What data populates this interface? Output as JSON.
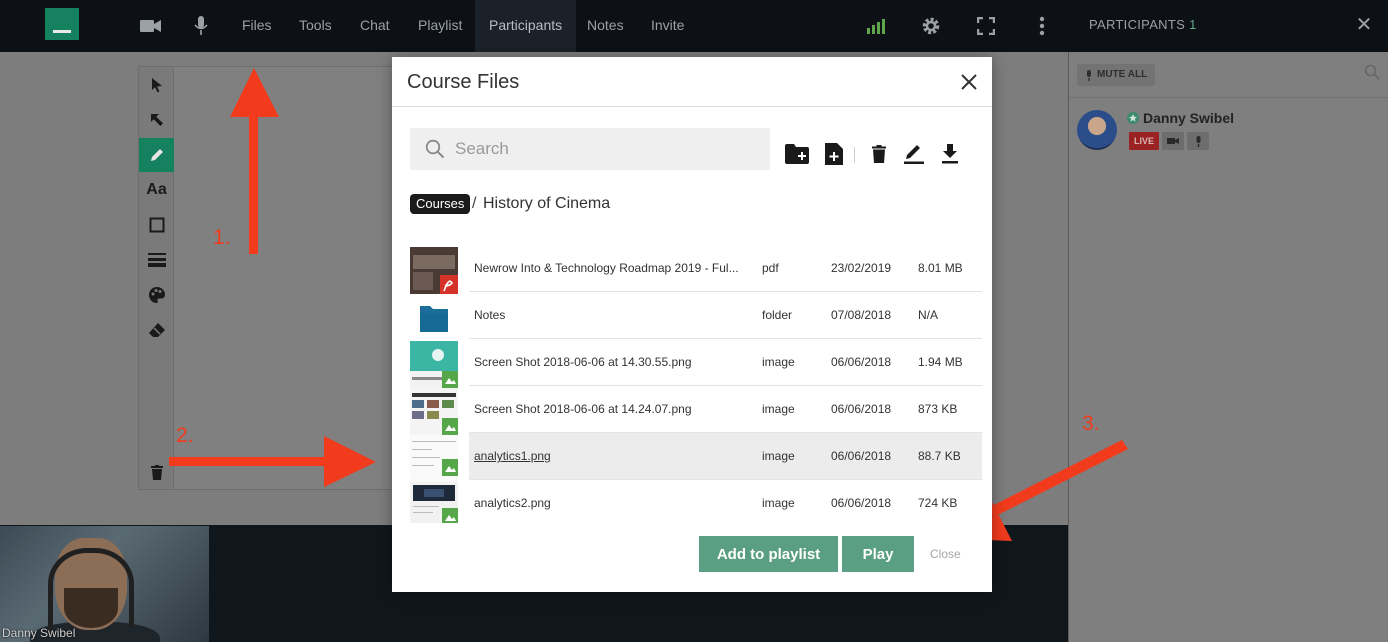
{
  "topbar": {
    "nav": [
      "Files",
      "Tools",
      "Chat",
      "Playlist",
      "Participants",
      "Notes",
      "Invite"
    ],
    "active_nav": "Participants",
    "participants_title": "PARTICIPANTS",
    "participants_count": "1"
  },
  "sidebar": {
    "mute_all_label": "MUTE ALL",
    "user": {
      "name": "Danny Swibel",
      "live_label": "LIVE"
    }
  },
  "video": {
    "name": "Danny Swibel"
  },
  "annotations": {
    "step1": "1.",
    "step2": "2.",
    "step3": "3."
  },
  "modal": {
    "title": "Course Files",
    "search_placeholder": "Search",
    "breadcrumb_root": "Courses",
    "breadcrumb_sep": "/",
    "breadcrumb_current": "History of Cinema",
    "files": [
      {
        "name": "Newrow Into & Technology Roadmap 2019 - Ful...",
        "type": "pdf",
        "date": "23/02/2019",
        "size": "8.01 MB",
        "thumb": "pdf"
      },
      {
        "name": "Notes",
        "type": "folder",
        "date": "07/08/2018",
        "size": "N/A",
        "thumb": "folder"
      },
      {
        "name": "Screen Shot 2018-06-06 at 14.30.55.png",
        "type": "image",
        "date": "06/06/2018",
        "size": "1.94 MB",
        "thumb": "image"
      },
      {
        "name": "Screen Shot 2018-06-06 at 14.24.07.png",
        "type": "image",
        "date": "06/06/2018",
        "size": "873 KB",
        "thumb": "image"
      },
      {
        "name": "analytics1.png",
        "type": "image",
        "date": "06/06/2018",
        "size": "88.7 KB",
        "thumb": "image"
      },
      {
        "name": "analytics2.png",
        "type": "image",
        "date": "06/06/2018",
        "size": "724 KB",
        "thumb": "image"
      }
    ],
    "selected_index": 4,
    "add_to_playlist_label": "Add to playlist",
    "play_label": "Play",
    "close_label": "Close"
  },
  "colors": {
    "accent": "#15815e",
    "button": "#5a9f84",
    "annotation": "#f23b1d",
    "live": "#9a2222"
  }
}
